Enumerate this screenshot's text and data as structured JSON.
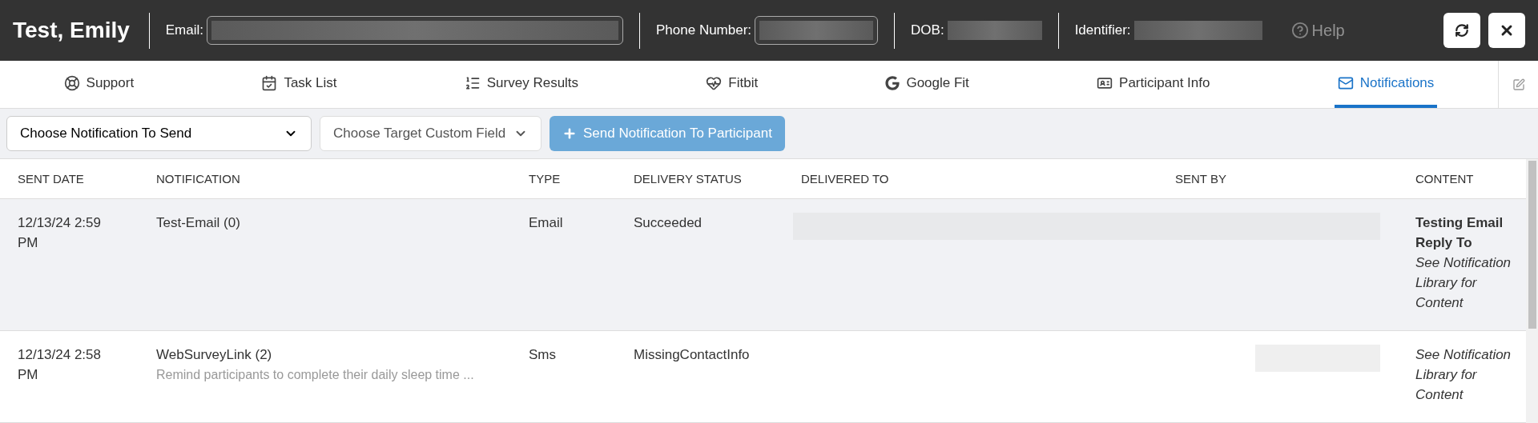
{
  "header": {
    "participant_name": "Test, Emily",
    "fields": [
      {
        "label": "Email:",
        "kind": "input"
      },
      {
        "label": "Phone Number:",
        "kind": "input"
      },
      {
        "label": "DOB:",
        "kind": "plain"
      },
      {
        "label": "Identifier:",
        "kind": "plain"
      }
    ],
    "background_menu": {
      "label": "Help"
    }
  },
  "tabs": [
    {
      "label": "Support",
      "selected": false
    },
    {
      "label": "Task List",
      "selected": false
    },
    {
      "label": "Survey Results",
      "selected": false
    },
    {
      "label": "Fitbit",
      "selected": false
    },
    {
      "label": "Google Fit",
      "selected": false
    },
    {
      "label": "Participant Info",
      "selected": false
    },
    {
      "label": "Notifications",
      "selected": true
    }
  ],
  "toolbar": {
    "notification_select": "Choose Notification To Send",
    "custom_field_select": "Choose Target Custom Field",
    "send_button": "Send Notification To Participant",
    "send_disabled": true
  },
  "table": {
    "columns": [
      "SENT DATE",
      "NOTIFICATION",
      "TYPE",
      "DELIVERY STATUS",
      "DELIVERED TO",
      "SENT BY",
      "CONTENT"
    ],
    "rows": [
      {
        "sent_date": "12/13/24 2:59 PM",
        "notification": "Test-Email (0)",
        "description": null,
        "type": "Email",
        "delivery_status": "Succeeded",
        "delivered_to_redacted": true,
        "sent_by_redacted": true,
        "content_title": "Testing Email Reply To",
        "content_note": "See Notification Library for Content",
        "highlighted": true
      },
      {
        "sent_date": "12/13/24 2:58 PM",
        "notification": "WebSurveyLink (2)",
        "description": "Remind participants to complete their daily sleep time ...",
        "type": "Sms",
        "delivery_status": "MissingContactInfo",
        "delivered_to_redacted": false,
        "sent_by_redacted": true,
        "content_title": null,
        "content_note": "See Notification Library for Content",
        "highlighted": false
      }
    ]
  }
}
